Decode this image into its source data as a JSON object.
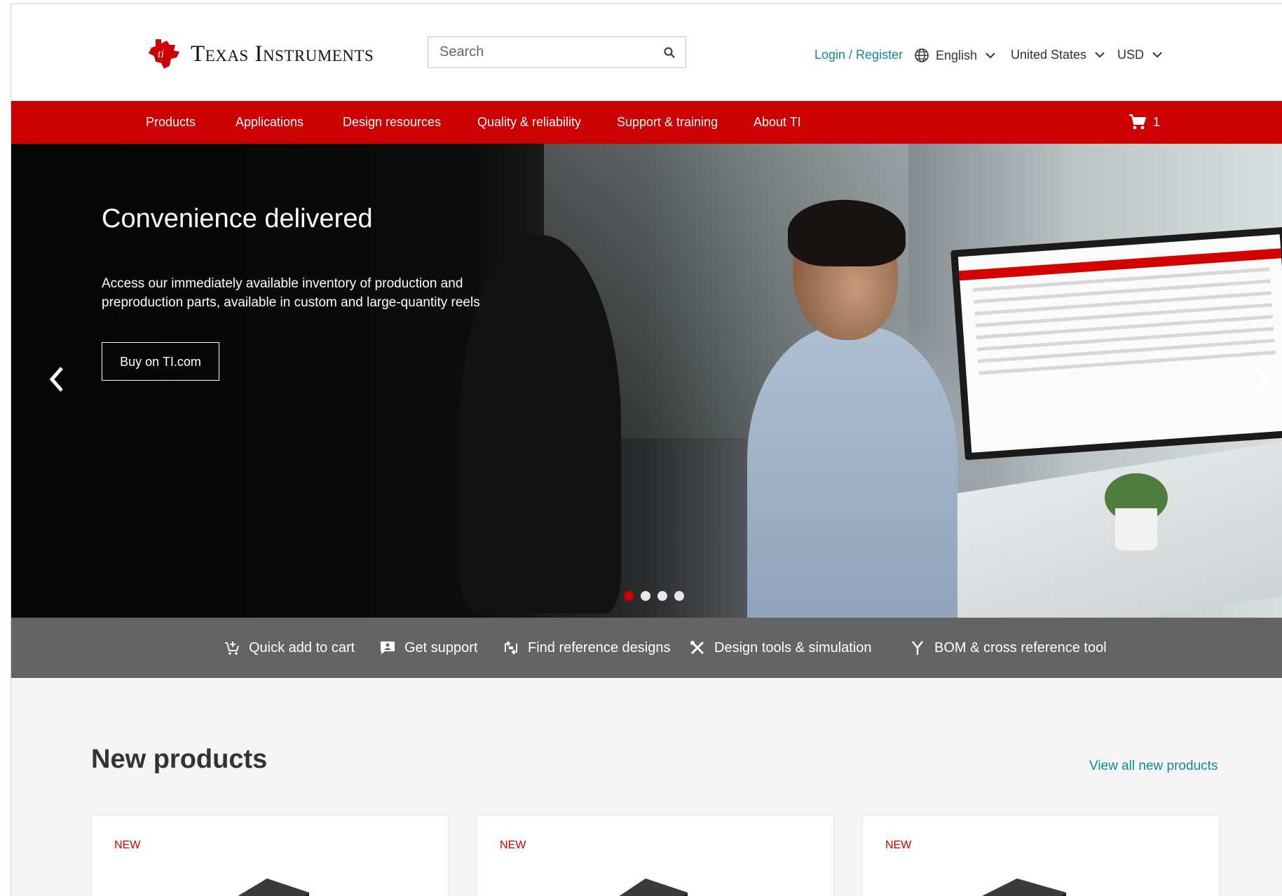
{
  "header": {
    "logo_text": "Texas Instruments",
    "search_placeholder": "Search",
    "login_label": "Login / Register",
    "language_label": "English",
    "country_label": "United States",
    "currency_label": "USD"
  },
  "nav": {
    "items": [
      "Products",
      "Applications",
      "Design resources",
      "Quality & reliability",
      "Support & training",
      "About TI"
    ],
    "cart_count": "1"
  },
  "hero": {
    "title": "Convenience delivered",
    "description": "Access our immediately available inventory of production and preproduction parts, available in custom and large-quantity reels",
    "button_label": "Buy on TI.com",
    "slide_count": 4,
    "active_slide": 1
  },
  "quick_links": [
    {
      "label": "Quick add to cart",
      "icon": "cart-add-icon"
    },
    {
      "label": "Get support",
      "icon": "support-icon"
    },
    {
      "label": "Find reference designs",
      "icon": "reference-design-icon"
    },
    {
      "label": "Design tools & simulation",
      "icon": "tools-icon"
    },
    {
      "label": "BOM & cross reference tool",
      "icon": "cross-reference-icon"
    }
  ],
  "new_products": {
    "title": "New products",
    "view_all_label": "View all new products",
    "cards": [
      {
        "badge": "NEW"
      },
      {
        "badge": "NEW"
      },
      {
        "badge": "NEW"
      }
    ]
  },
  "colors": {
    "brand_red": "#cc0000",
    "link_teal": "#118899",
    "quick_bar_gray": "#646464"
  }
}
